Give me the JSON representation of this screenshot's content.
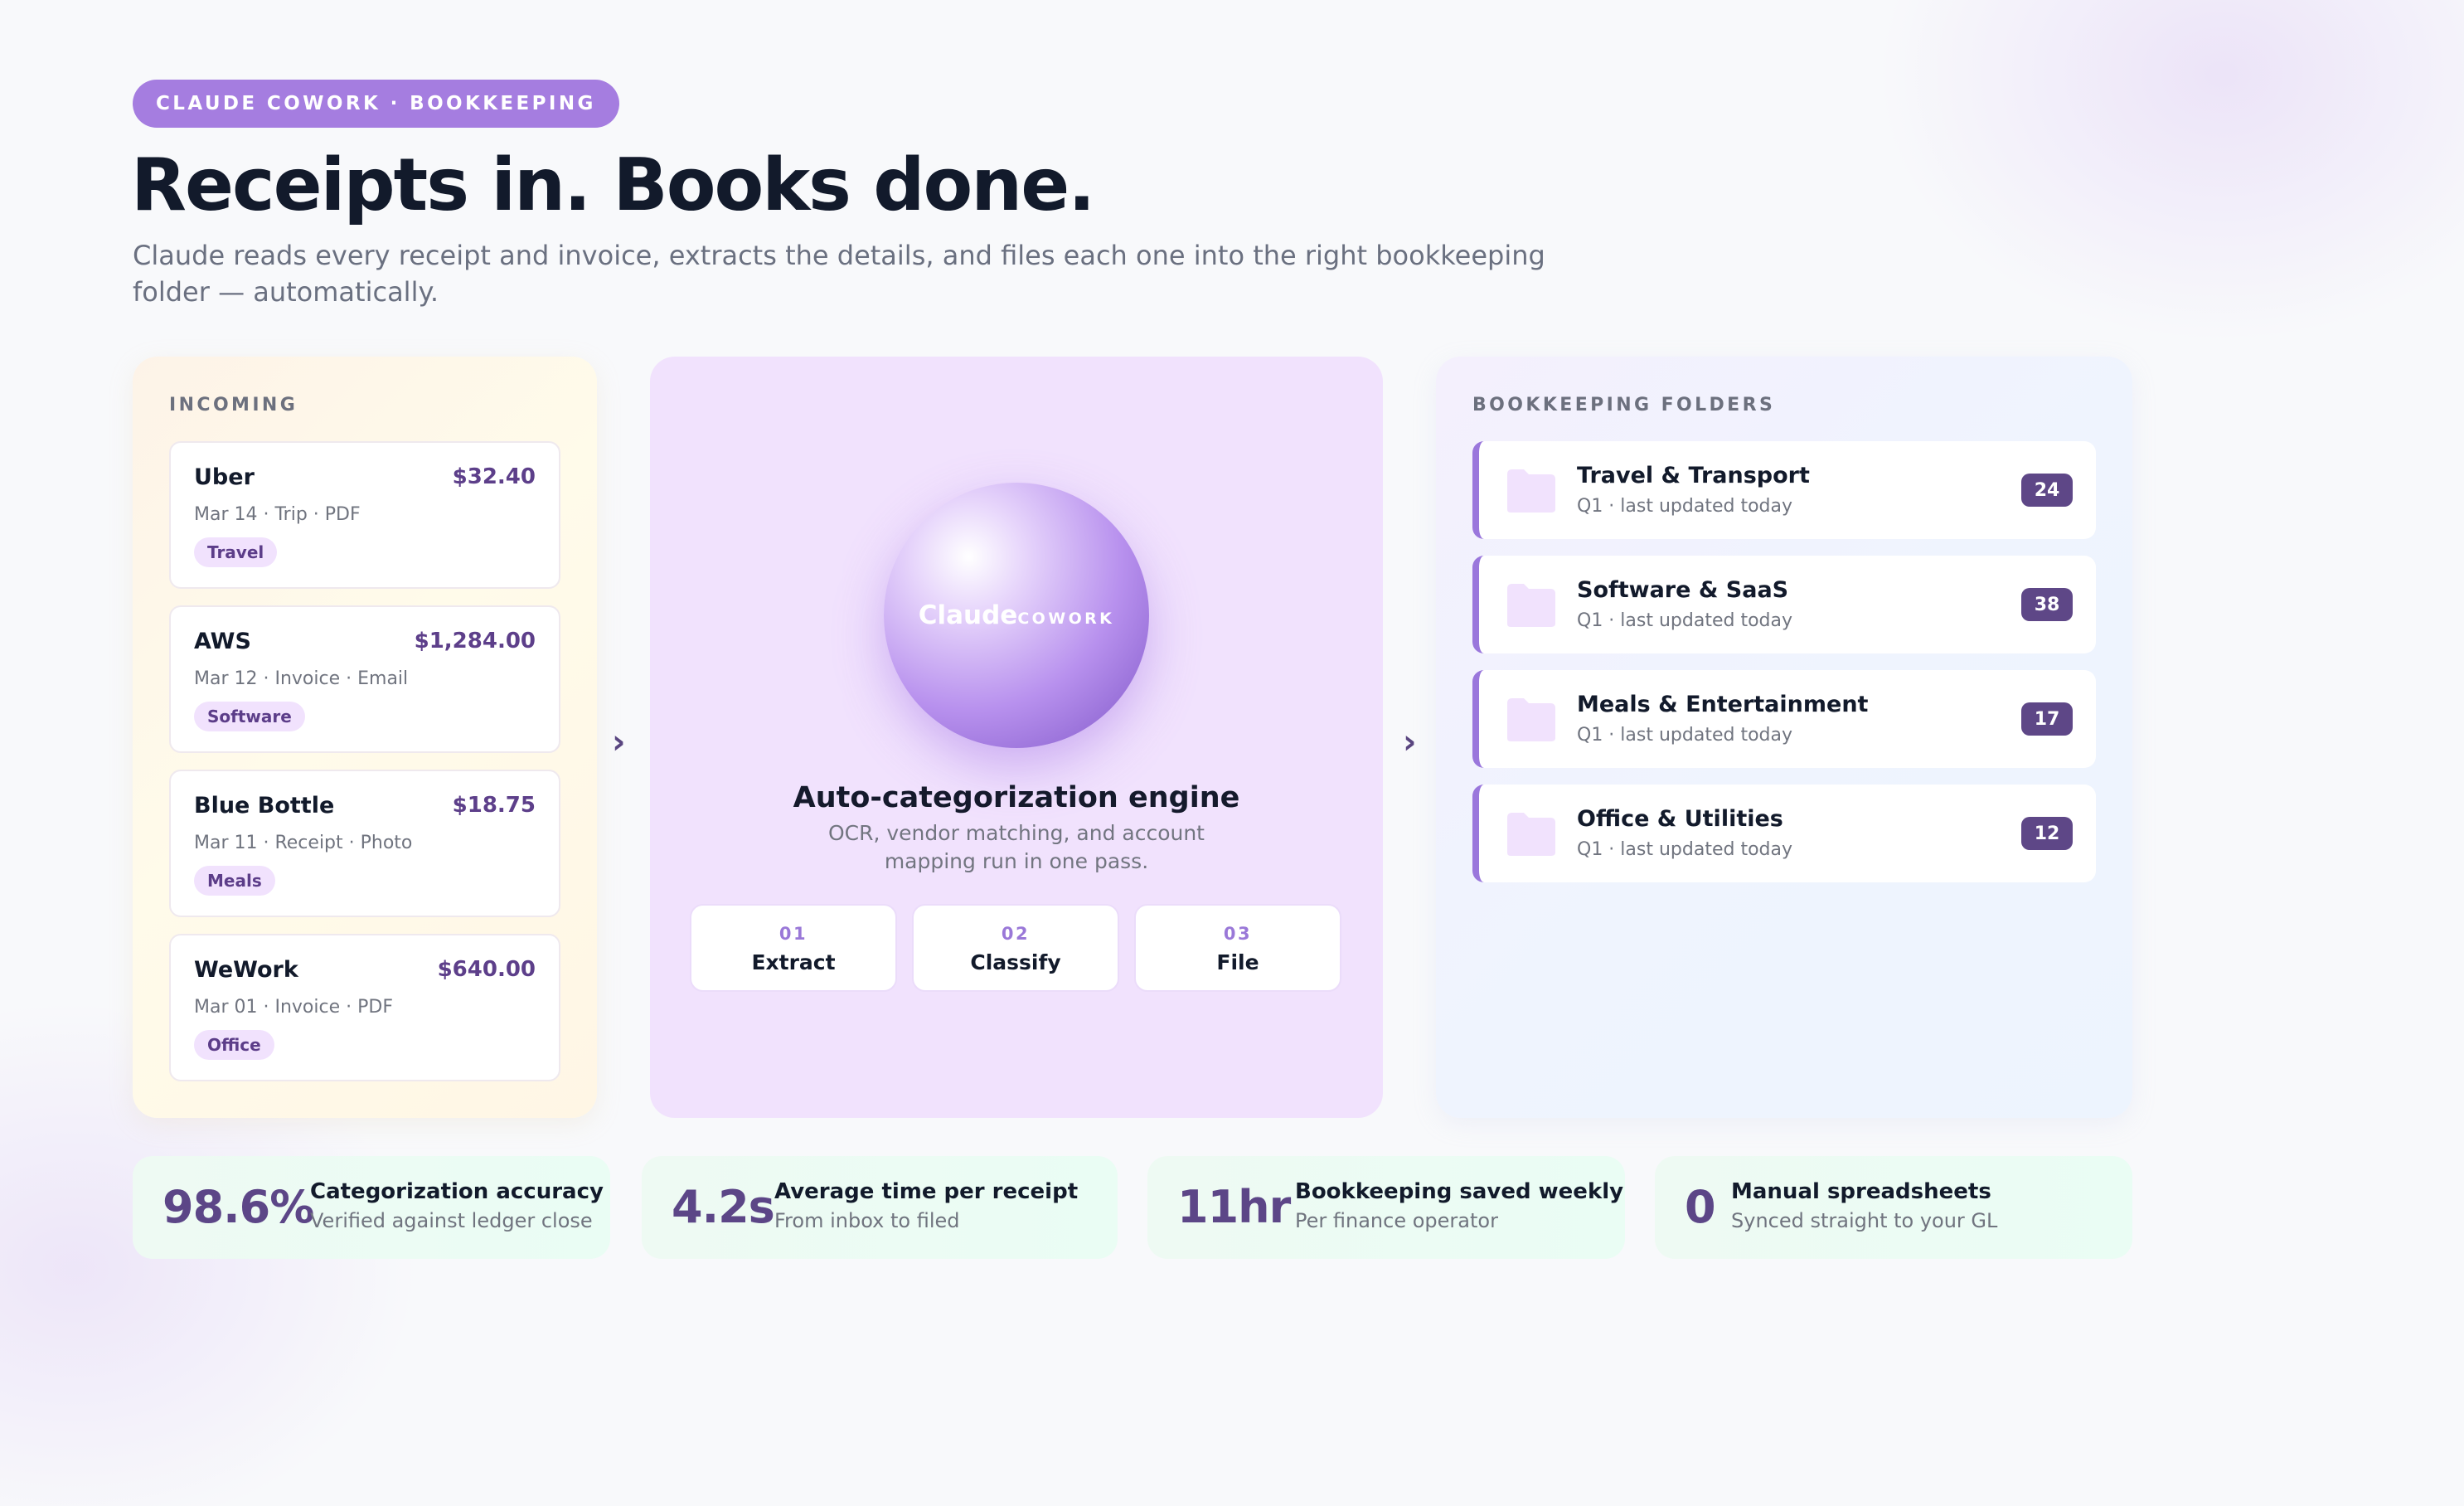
{
  "eyebrow": "CLAUDE COWORK · BOOKKEEPING",
  "hero": {
    "title": "Receipts in. Books done.",
    "subtitle": "Claude reads every receipt and invoice, extracts the details, and files each one into the right bookkeeping folder — automatically."
  },
  "incoming": {
    "label": "INCOMING",
    "receipts": [
      {
        "vendor": "Uber",
        "amount": "$32.40",
        "meta": "Mar 14 · Trip · PDF",
        "tag": "Travel"
      },
      {
        "vendor": "AWS",
        "amount": "$1,284.00",
        "meta": "Mar 12 · Invoice · Email",
        "tag": "Software"
      },
      {
        "vendor": "Blue Bottle",
        "amount": "$18.75",
        "meta": "Mar 11 · Receipt · Photo",
        "tag": "Meals"
      },
      {
        "vendor": "WeWork",
        "amount": "$640.00",
        "meta": "Mar 01 · Invoice · PDF",
        "tag": "Office"
      }
    ]
  },
  "flow_arrow": "›",
  "engine": {
    "orb_brand": "Claude",
    "orb_sub": "COWORK",
    "title": "Auto-categorization engine",
    "description": "OCR, vendor matching, and account mapping run in one pass.",
    "steps": [
      {
        "num": "01",
        "name": "Extract"
      },
      {
        "num": "02",
        "name": "Classify"
      },
      {
        "num": "03",
        "name": "File"
      }
    ]
  },
  "folders": {
    "label": "BOOKKEEPING FOLDERS",
    "icon": "folder-icon",
    "items": [
      {
        "name": "Travel & Transport",
        "meta": "Q1 · last updated today",
        "count": "24"
      },
      {
        "name": "Software & SaaS",
        "meta": "Q1 · last updated today",
        "count": "38"
      },
      {
        "name": "Meals & Entertainment",
        "meta": "Q1 · last updated today",
        "count": "17"
      },
      {
        "name": "Office & Utilities",
        "meta": "Q1 · last updated today",
        "count": "12"
      }
    ]
  },
  "stats": [
    {
      "value": "98.6%",
      "label": "Categorization accuracy",
      "sub": "Verified against ledger close"
    },
    {
      "value": "4.2s",
      "label": "Average time per receipt",
      "sub": "From inbox to filed"
    },
    {
      "value": "11hr",
      "label": "Bookkeeping saved weekly",
      "sub": "Per finance operator"
    },
    {
      "value": "0",
      "label": "Manual spreadsheets",
      "sub": "Synced straight to your GL"
    }
  ],
  "colors": {
    "accent": "#a57de0",
    "accent_dark": "#5e4787",
    "engine_bg": "#f1e2fd",
    "stat_bg": "#eefaf3"
  }
}
